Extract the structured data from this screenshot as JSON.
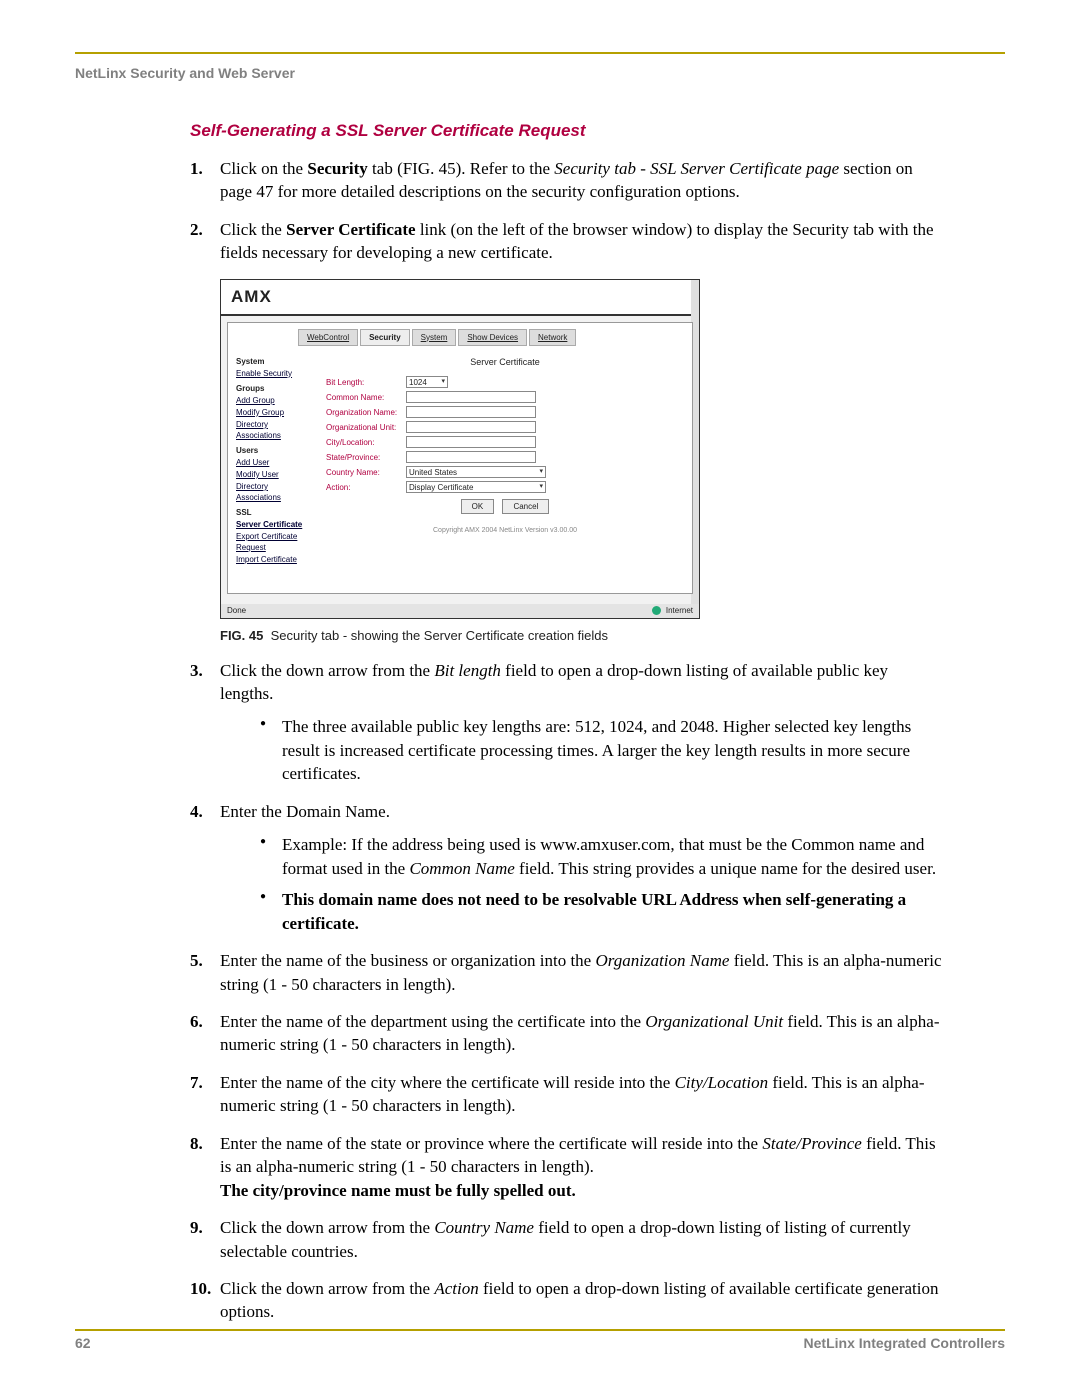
{
  "header": {
    "left": "NetLinx Security and Web Server"
  },
  "section_title": "Self-Generating a SSL Server Certificate Request",
  "steps": [
    {
      "num": "1.",
      "html": "Click on the <b class='term'>Security</b> tab (FIG. 45). Refer to the <i class='term'>Security tab - SSL Server Certificate page</i> section on page 47 for more detailed descriptions on the security configuration options."
    },
    {
      "num": "2.",
      "html": "Click the <b class='term'>Server Certificate</b> link (on the left of the browser window) to display the Security tab with the fields necessary for developing a new certificate."
    }
  ],
  "figure": {
    "logo": "AMX",
    "tabs": [
      "WebControl",
      "Security",
      "System",
      "Show Devices",
      "Network"
    ],
    "active_tab_index": 1,
    "side": {
      "groups": [
        {
          "head": "System",
          "links": [
            "Enable Security"
          ]
        },
        {
          "head": "Groups",
          "links": [
            "Add Group",
            "Modify Group",
            "Directory Associations"
          ]
        },
        {
          "head": "Users",
          "links": [
            "Add User",
            "Modify User",
            "Directory Associations"
          ]
        },
        {
          "head": "SSL",
          "links": [
            "Server Certificate",
            "Export Certificate Request",
            "Import Certificate"
          ]
        }
      ],
      "bold_link": "Server Certificate"
    },
    "main_title": "Server Certificate",
    "fields": [
      {
        "label": "Bit Length:",
        "type": "select",
        "value": "1024",
        "size": "sm"
      },
      {
        "label": "Common Name:",
        "type": "text",
        "value": ""
      },
      {
        "label": "Organization Name:",
        "type": "text",
        "value": ""
      },
      {
        "label": "Organizational Unit:",
        "type": "text",
        "value": ""
      },
      {
        "label": "City/Location:",
        "type": "text",
        "value": ""
      },
      {
        "label": "State/Province:",
        "type": "text",
        "value": ""
      },
      {
        "label": "Country Name:",
        "type": "select",
        "value": "United States",
        "size": "md"
      },
      {
        "label": "Action:",
        "type": "select",
        "value": "Display Certificate",
        "size": "md"
      }
    ],
    "buttons": [
      "OK",
      "Cancel"
    ],
    "copyright": "Copyright AMX 2004   NetLinx Version v3.00.00",
    "statusbar_left": "Done",
    "statusbar_right": "Internet"
  },
  "figure_caption": {
    "label": "FIG. 45",
    "text": "Security tab - showing the Server Certificate creation fields"
  },
  "steps2": [
    {
      "num": "3.",
      "html": "Click the down arrow from the <i class='term'>Bit length</i> field to open a drop-down listing of available public key lengths.",
      "bullets": [
        "The three available public key lengths are: 512, 1024, and 2048. Higher selected key lengths result is increased certificate processing times. A larger the key length results in more secure certificates."
      ]
    },
    {
      "num": "4.",
      "html": "Enter the Domain Name.",
      "bullets": [
        "Example: If the address being used is www.amxuser.com, that must be the Common name and format used in the <i class='term'>Common Name</i> field. This string provides a unique name for the desired user.",
        "<b class='term'>This domain name does not need to be resolvable URL Address when self-generating a certificate.</b>"
      ]
    },
    {
      "num": "5.",
      "html": "Enter the name of the business or organization into the <i class='term'>Organization Name</i> field. This is an alpha-numeric string (1 - 50 characters in length)."
    },
    {
      "num": "6.",
      "html": "Enter the name of the department using the certificate into the <i class='term'>Organizational Unit</i> field. This is an alpha-numeric string (1 - 50 characters in length)."
    },
    {
      "num": "7.",
      "html": "Enter the name of the city where the certificate will reside into the <i class='term'>City/Location</i> field. This is an alpha-numeric string (1 - 50 characters in length)."
    },
    {
      "num": "8.",
      "html": "Enter the name of the state or province where the certificate will reside into the <i class='term'>State/Province</i> field. This is an alpha-numeric string (1 - 50 characters in length).<br><b class='term'>The city/province name must be fully spelled out.</b>"
    },
    {
      "num": "9.",
      "html": "Click the down arrow from the <i class='term'>Country Name</i> field to open a drop-down listing of listing of currently selectable countries."
    },
    {
      "num": "10.",
      "html": "Click the down arrow from the <i class='term'>Action</i> field to open a drop-down listing of available certificate generation options."
    }
  ],
  "footer": {
    "page": "62",
    "right": "NetLinx Integrated Controllers"
  }
}
